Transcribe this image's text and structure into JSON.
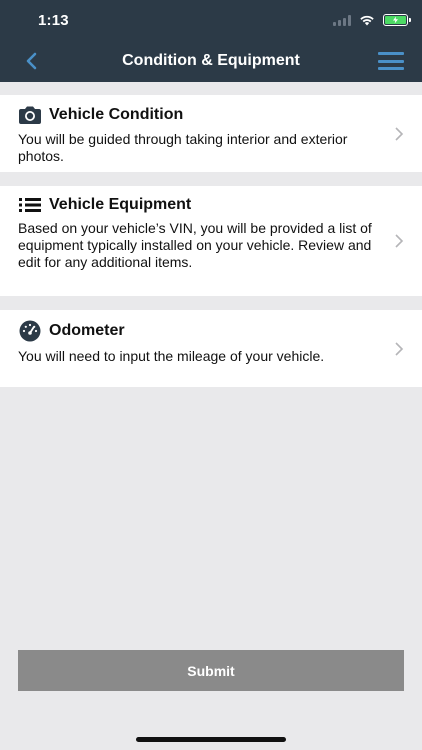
{
  "status": {
    "time": "1:13"
  },
  "nav": {
    "title": "Condition & Equipment"
  },
  "sections": [
    {
      "title": "Vehicle Condition",
      "icon": "camera-icon",
      "description": "You will be guided through taking interior and exterior photos."
    },
    {
      "title": "Vehicle Equipment",
      "icon": "list-icon",
      "description": "Based on your vehicle’s VIN, you will be provided a list of equipment typically installed on your vehicle. Review and edit for any additional items."
    },
    {
      "title": "Odometer",
      "icon": "speedometer-icon",
      "description": "You will need to input the mileage of your vehicle."
    }
  ],
  "submit_label": "Submit",
  "colors": {
    "header": "#2c3a47",
    "accent": "#4a90c8",
    "background": "#e9e9eb",
    "button": "#8a8a8a",
    "battery": "#4cd964"
  }
}
